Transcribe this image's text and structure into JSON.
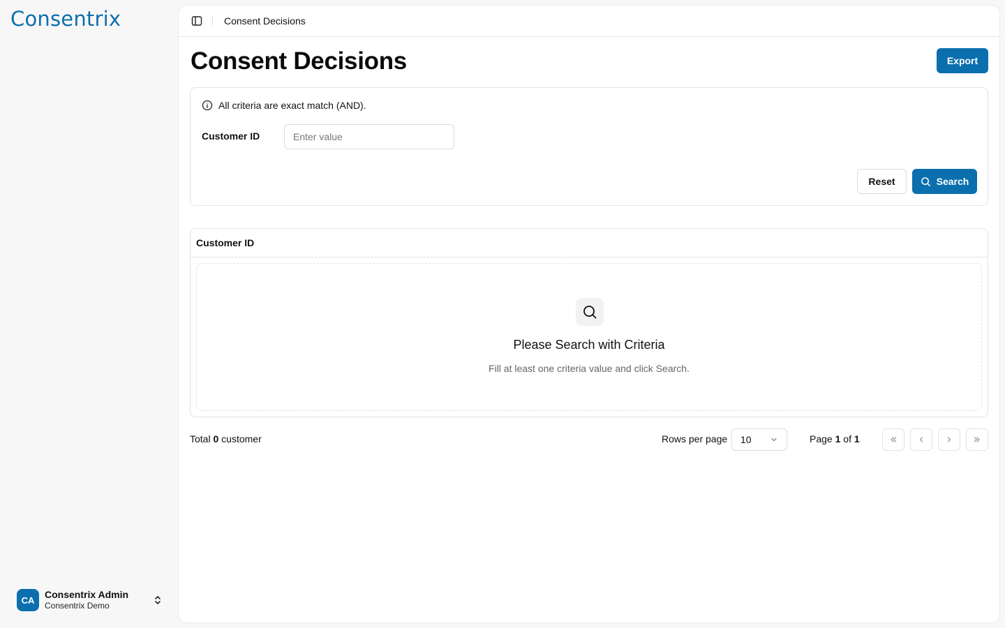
{
  "brand": {
    "logo_text": "Consentrix",
    "accent": "#0b6fae"
  },
  "sidebar": {
    "user": {
      "initials": "CA",
      "name": "Consentrix Admin",
      "org": "Consentrix Demo"
    }
  },
  "topbar": {
    "breadcrumb": "Consent Decisions"
  },
  "page": {
    "title": "Consent Decisions",
    "export_label": "Export"
  },
  "criteria": {
    "info_text": "All criteria are exact match (AND).",
    "field_label": "Customer ID",
    "field_placeholder": "Enter value",
    "reset_label": "Reset",
    "search_label": "Search"
  },
  "results": {
    "column_header": "Customer ID",
    "empty_title": "Please Search with Criteria",
    "empty_desc": "Fill at least one criteria value and click Search."
  },
  "pagination": {
    "total_prefix": "Total",
    "total_count": "0",
    "total_suffix": "customer",
    "rows_label": "Rows per page",
    "rows_value": "10",
    "page_prefix": "Page",
    "page_current": "1",
    "page_of": "of",
    "page_total": "1"
  },
  "icons": {
    "panel": "sidebar-panel-icon",
    "info": "info-circle-icon",
    "search": "search-icon",
    "chevron": "chevron-down-icon",
    "first": "chevrons-left-icon",
    "prev": "chevron-left-icon",
    "next": "chevron-right-icon",
    "last": "chevrons-right-icon"
  }
}
